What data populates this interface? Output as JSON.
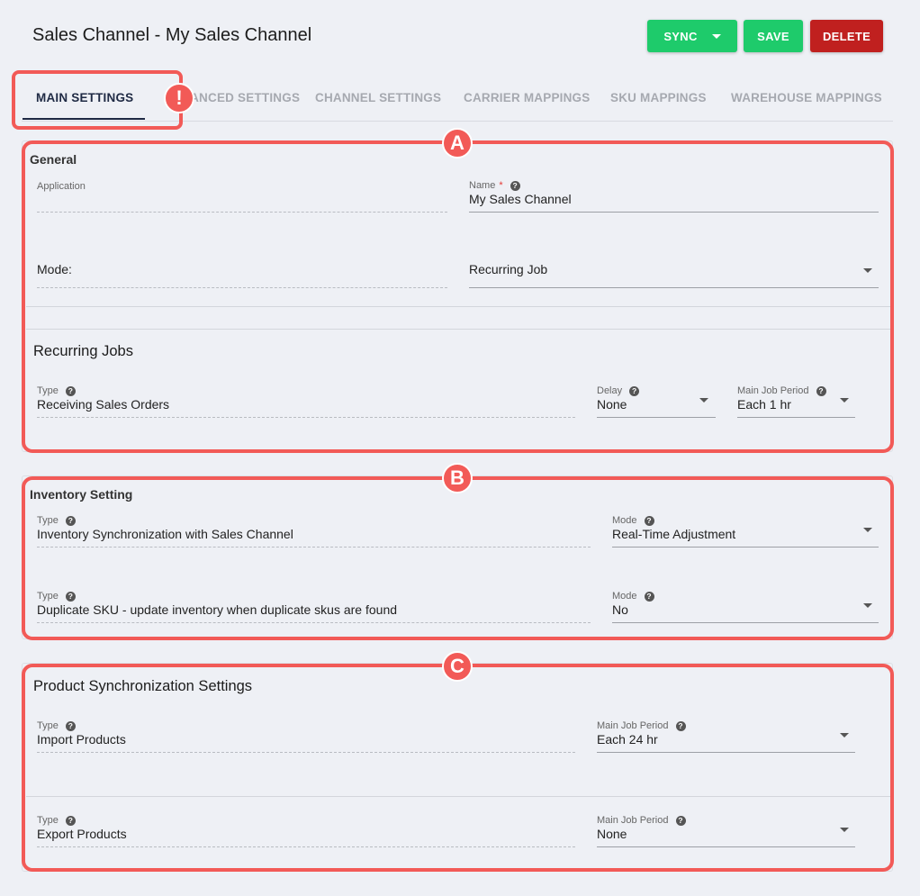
{
  "header": {
    "title": "Sales Channel - My Sales Channel",
    "sync_label": "SYNC",
    "save_label": "SAVE",
    "delete_label": "DELETE"
  },
  "tabs": [
    {
      "label": "MAIN SETTINGS",
      "active": true
    },
    {
      "label": "ADVANCED SETTINGS"
    },
    {
      "label": "CHANNEL SETTINGS"
    },
    {
      "label": "CARRIER MAPPINGS"
    },
    {
      "label": "SKU MAPPINGS"
    },
    {
      "label": "WAREHOUSE MAPPINGS"
    }
  ],
  "callouts": {
    "tab_alert": "!",
    "a": "A",
    "b": "B",
    "c": "C"
  },
  "general": {
    "title": "General",
    "application_label": "Application",
    "application_value": "",
    "name_label": "Name",
    "name_required": "*",
    "name_value": "My Sales Channel",
    "mode_label": "Mode:",
    "mode_value": "Recurring Job"
  },
  "recurring_jobs": {
    "title": "Recurring Jobs",
    "type_label": "Type",
    "type_value": "Receiving Sales Orders",
    "delay_label": "Delay",
    "delay_value": "None",
    "period_label": "Main Job Period",
    "period_value": "Each 1 hr"
  },
  "inventory": {
    "title": "Inventory Setting",
    "rows": [
      {
        "type_label": "Type",
        "type_value": "Inventory Synchronization with Sales Channel",
        "mode_label": "Mode",
        "mode_value": "Real-Time Adjustment"
      },
      {
        "type_label": "Type",
        "type_value": "Duplicate SKU - update inventory when duplicate skus are found",
        "mode_label": "Mode",
        "mode_value": "No"
      }
    ]
  },
  "products": {
    "title": "Product Synchronization Settings",
    "rows": [
      {
        "type_label": "Type",
        "type_value": "Import Products",
        "period_label": "Main Job Period",
        "period_value": "Each 24 hr"
      },
      {
        "type_label": "Type",
        "type_value": "Export Products",
        "period_label": "Main Job Period",
        "period_value": "None"
      }
    ]
  },
  "colors": {
    "green": "#1ecb6b",
    "red": "#c0201f",
    "highlight": "#f25a57"
  }
}
